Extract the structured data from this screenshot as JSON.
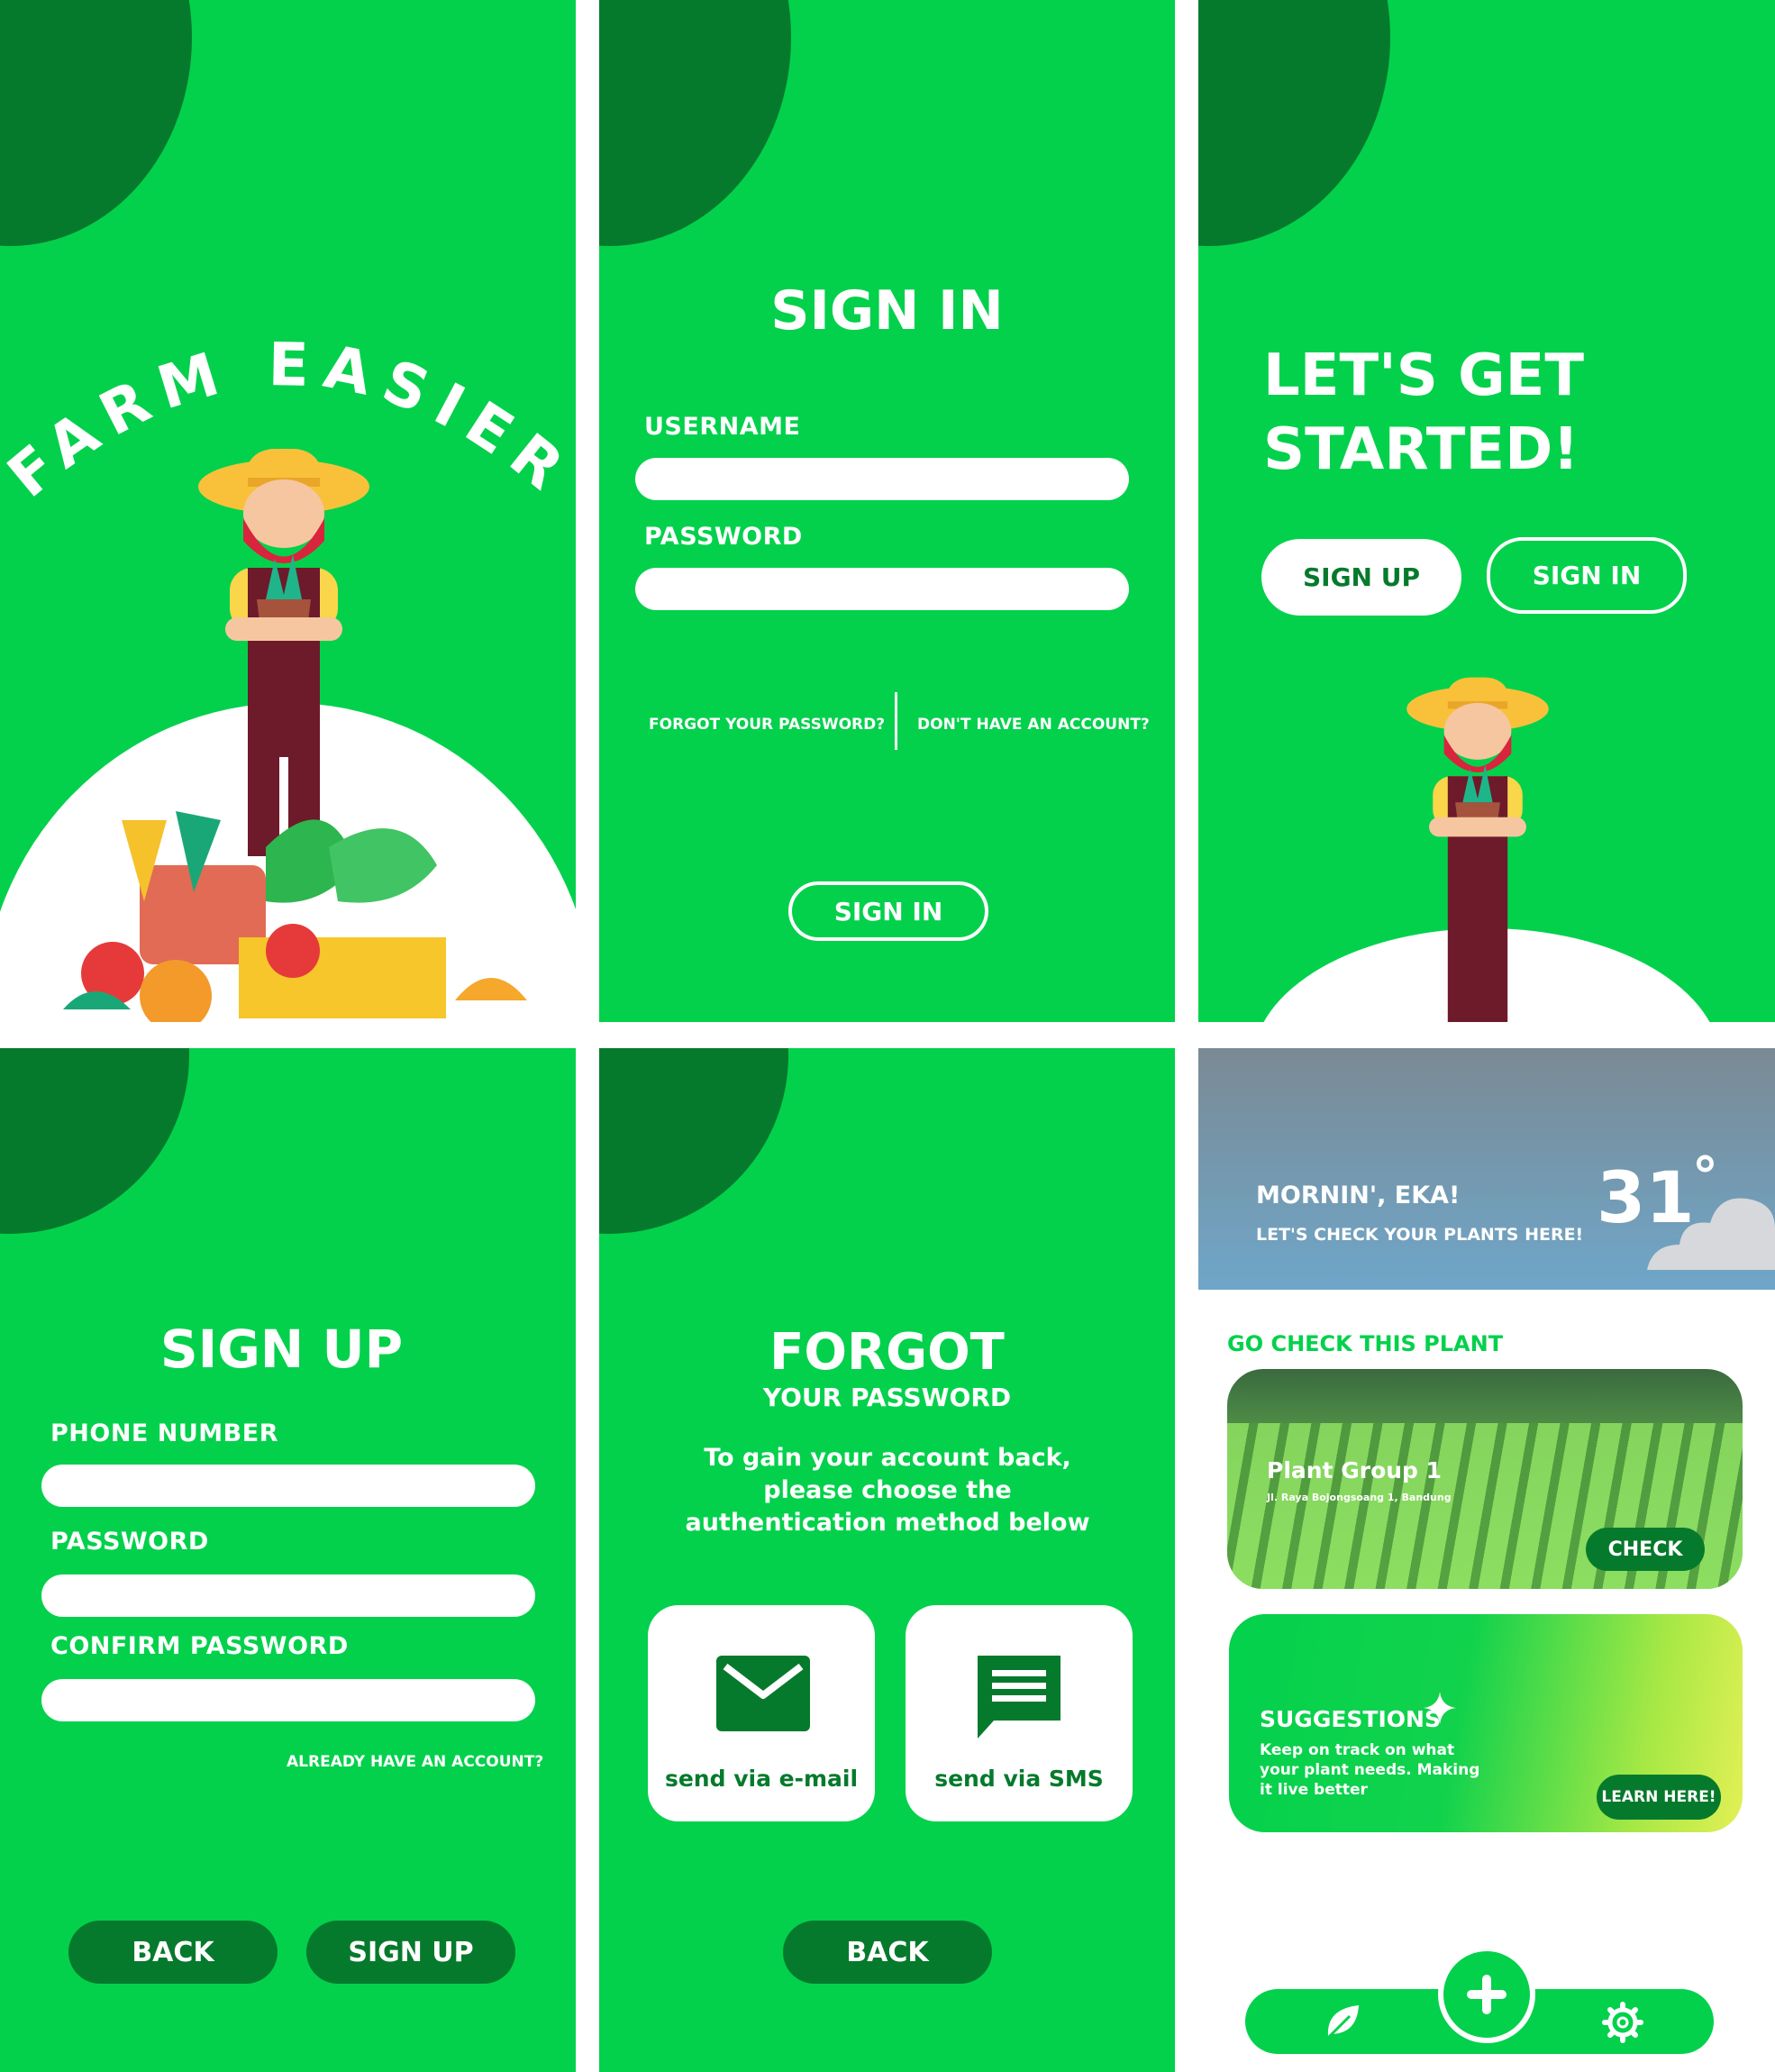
{
  "splash": {
    "title": "FARM EASIER"
  },
  "signin": {
    "title": "SIGN IN",
    "username_label": "USERNAME",
    "password_label": "PASSWORD",
    "forgot_link": "FORGOT YOUR PASSWORD?",
    "no_account_link": "DON'T HAVE AN ACCOUNT?",
    "signin_button": "SIGN IN"
  },
  "getstarted": {
    "title_line1": "LET'S GET",
    "title_line2": "STARTED!",
    "signup_button": "SIGN UP",
    "signin_button": "SIGN IN"
  },
  "signup": {
    "title": "SIGN UP",
    "phone_label": "PHONE NUMBER",
    "password_label": "PASSWORD",
    "confirm_label": "CONFIRM PASSWORD",
    "have_account_link": "ALREADY HAVE AN ACCOUNT?",
    "back_button": "BACK",
    "signup_button": "SIGN UP"
  },
  "forgot": {
    "title": "FORGOT",
    "subtitle": "YOUR PASSWORD",
    "instructions": "To gain your account back, please choose the authentication method below",
    "email_option": "send via e-mail",
    "sms_option": "send via SMS",
    "back_button": "BACK"
  },
  "home": {
    "greeting": "MORNIN', EKA!",
    "subgreeting": "LET'S CHECK YOUR PLANTS HERE!",
    "temperature": "31",
    "degree": "°",
    "section_title": "GO CHECK THIS PLANT",
    "plant_name": "Plant Group 1",
    "plant_address": "Jl. Raya Bojongsoang 1, Bandung",
    "check_button": "CHECK",
    "suggestions_title": "SUGGESTIONS",
    "suggestions_text": "Keep on track on what your plant needs. Making it live better",
    "learn_button": "LEARN HERE!"
  },
  "colors": {
    "green": "#03d14c",
    "dark_green": "#067a2c",
    "white": "#ffffff"
  },
  "icons": [
    "envelope-icon",
    "message-icon",
    "leaf-icon",
    "plus-icon",
    "gear-icon",
    "sparkle-icon",
    "cloud-icon"
  ]
}
